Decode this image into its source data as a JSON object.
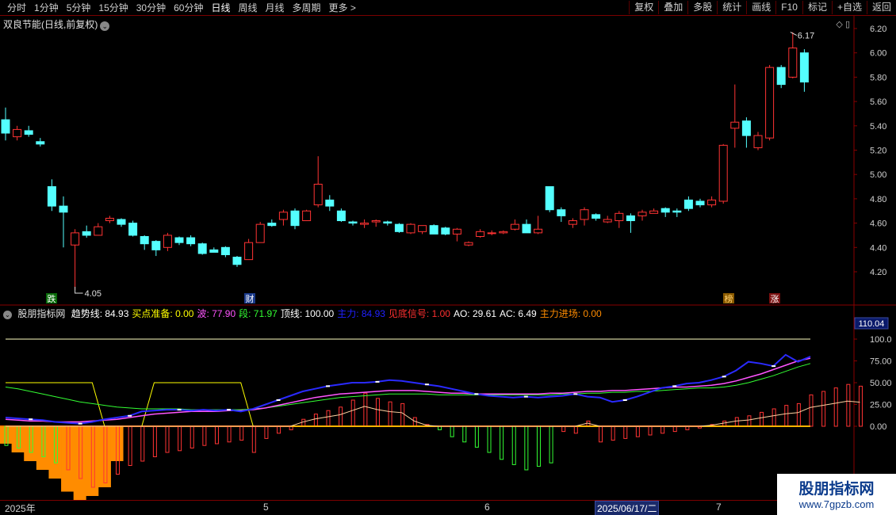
{
  "toolbar": {
    "periods": [
      "分时",
      "1分钟",
      "5分钟",
      "15分钟",
      "30分钟",
      "60分钟",
      "日线",
      "周线",
      "月线",
      "多周期",
      "更多 >"
    ],
    "actions": [
      "复权",
      "叠加",
      "多股",
      "统计",
      "画线",
      "F10",
      "标记",
      "+自选",
      "返回"
    ]
  },
  "main_title": "双良节能(日线,前复权)",
  "price_axis": [
    "6.20",
    "6.00",
    "5.80",
    "5.60",
    "5.40",
    "5.20",
    "5.00",
    "4.80",
    "4.60",
    "4.40",
    "4.20"
  ],
  "annotations": {
    "high": "6.17",
    "low": "4.05"
  },
  "markers": {
    "die": "跌",
    "cai": "财",
    "bang": "榜",
    "zhang": "涨"
  },
  "indicator": {
    "name": "股朋指标网",
    "items": [
      {
        "label": "趋势线: 84.93",
        "color": "#ffffff"
      },
      {
        "label": "买点准备: 0.00",
        "color": "#ffff00"
      },
      {
        "label": "波: 77.90",
        "color": "#ff55ff"
      },
      {
        "label": "段: 71.97",
        "color": "#33ff33"
      },
      {
        "label": "顶线: 100.00",
        "color": "#ffffff"
      },
      {
        "label": "主力: 84.93",
        "color": "#2020ff"
      },
      {
        "label": "见底信号: 1.00",
        "color": "#ff3030"
      },
      {
        "label": "AO: 29.61",
        "color": "#ffffff"
      },
      {
        "label": "AC: 6.49",
        "color": "#ffffff"
      },
      {
        "label": "主力进场: 0.00",
        "color": "#ff8c00"
      }
    ],
    "axis": [
      "100.0",
      "75.00",
      "50.00",
      "25.00",
      "0.00"
    ],
    "axis_top_value": "110.04"
  },
  "dates": {
    "year": "2025年",
    "m5": "5",
    "m6": "6",
    "m7": "7",
    "selected": "2025/06/17/二"
  },
  "watermark": {
    "line1": "股朋指标网",
    "line2": "www.7gpzb.com"
  },
  "chart_data": {
    "type": "candlestick",
    "candles": [
      [
        5.45,
        5.34,
        5.55,
        5.28
      ],
      [
        5.31,
        5.37,
        5.4,
        5.28
      ],
      [
        5.36,
        5.33,
        5.4,
        5.31
      ],
      [
        5.27,
        5.25,
        5.3,
        5.23
      ],
      [
        4.9,
        4.74,
        4.96,
        4.7
      ],
      [
        4.74,
        4.69,
        4.82,
        4.4
      ],
      [
        4.42,
        4.52,
        4.55,
        4.05
      ],
      [
        4.53,
        4.5,
        4.58,
        4.48
      ],
      [
        4.5,
        4.57,
        4.6,
        4.5
      ],
      [
        4.62,
        4.64,
        4.66,
        4.6
      ],
      [
        4.63,
        4.59,
        4.64,
        4.57
      ],
      [
        4.6,
        4.5,
        4.62,
        4.49
      ],
      [
        4.49,
        4.43,
        4.5,
        4.38
      ],
      [
        4.45,
        4.38,
        4.46,
        4.33
      ],
      [
        4.4,
        4.5,
        4.52,
        4.37
      ],
      [
        4.48,
        4.44,
        4.49,
        4.42
      ],
      [
        4.48,
        4.43,
        4.5,
        4.41
      ],
      [
        4.43,
        4.35,
        4.44,
        4.34
      ],
      [
        4.38,
        4.36,
        4.4,
        4.36
      ],
      [
        4.4,
        4.34,
        4.41,
        4.32
      ],
      [
        4.32,
        4.26,
        4.33,
        4.24
      ],
      [
        4.3,
        4.44,
        4.47,
        4.3
      ],
      [
        4.44,
        4.59,
        4.61,
        4.44
      ],
      [
        4.6,
        4.58,
        4.63,
        4.57
      ],
      [
        4.63,
        4.69,
        4.71,
        4.58
      ],
      [
        4.7,
        4.58,
        4.72,
        4.55
      ],
      [
        4.62,
        4.7,
        4.71,
        4.62
      ],
      [
        4.75,
        4.92,
        5.15,
        4.73
      ],
      [
        4.79,
        4.74,
        4.83,
        4.7
      ],
      [
        4.7,
        4.62,
        4.72,
        4.61
      ],
      [
        4.61,
        4.6,
        4.62,
        4.58
      ],
      [
        4.59,
        4.6,
        4.63,
        4.56
      ],
      [
        4.61,
        4.62,
        4.63,
        4.57
      ],
      [
        4.61,
        4.6,
        4.62,
        4.58
      ],
      [
        4.59,
        4.53,
        4.6,
        4.52
      ],
      [
        4.52,
        4.59,
        4.6,
        4.51
      ],
      [
        4.53,
        4.58,
        4.58,
        4.51
      ],
      [
        4.58,
        4.51,
        4.59,
        4.51
      ],
      [
        4.56,
        4.51,
        4.57,
        4.5
      ],
      [
        4.51,
        4.55,
        4.56,
        4.45
      ],
      [
        4.42,
        4.44,
        4.45,
        4.41
      ],
      [
        4.49,
        4.53,
        4.55,
        4.48
      ],
      [
        4.52,
        4.52,
        4.54,
        4.5
      ],
      [
        4.52,
        4.53,
        4.54,
        4.51
      ],
      [
        4.55,
        4.59,
        4.63,
        4.54
      ],
      [
        4.59,
        4.52,
        4.63,
        4.52
      ],
      [
        4.52,
        4.55,
        4.66,
        4.51
      ],
      [
        4.9,
        4.71,
        4.9,
        4.69
      ],
      [
        4.71,
        4.66,
        4.73,
        4.61
      ],
      [
        4.59,
        4.62,
        4.64,
        4.56
      ],
      [
        4.63,
        4.71,
        4.73,
        4.58
      ],
      [
        4.67,
        4.64,
        4.68,
        4.62
      ],
      [
        4.61,
        4.63,
        4.66,
        4.6
      ],
      [
        4.62,
        4.68,
        4.7,
        4.56
      ],
      [
        4.66,
        4.62,
        4.68,
        4.52
      ],
      [
        4.66,
        4.69,
        4.71,
        4.62
      ],
      [
        4.68,
        4.7,
        4.72,
        4.68
      ],
      [
        4.72,
        4.69,
        4.73,
        4.65
      ],
      [
        4.7,
        4.69,
        4.72,
        4.65
      ],
      [
        4.79,
        4.72,
        4.82,
        4.7
      ],
      [
        4.78,
        4.75,
        4.8,
        4.73
      ],
      [
        4.75,
        4.79,
        4.82,
        4.73
      ],
      [
        4.78,
        5.24,
        5.25,
        4.76
      ],
      [
        5.38,
        5.43,
        5.74,
        5.22
      ],
      [
        5.44,
        5.32,
        5.47,
        5.22
      ],
      [
        5.22,
        5.32,
        5.35,
        5.2
      ],
      [
        5.3,
        5.88,
        5.9,
        5.28
      ],
      [
        5.88,
        5.74,
        5.9,
        5.71
      ],
      [
        5.8,
        6.04,
        6.17,
        5.79
      ],
      [
        6.0,
        5.76,
        6.03,
        5.68
      ]
    ],
    "indicator_series": {
      "trend": [
        10,
        9,
        8,
        7,
        5,
        4,
        3,
        5,
        8,
        10,
        12,
        17,
        18,
        19,
        19,
        18,
        19,
        18,
        19,
        17,
        20,
        25,
        30,
        35,
        40,
        43,
        46,
        48,
        50,
        50,
        51,
        53,
        52,
        50,
        48,
        46,
        43,
        40,
        37,
        35,
        34,
        33,
        34,
        33,
        34,
        35,
        37,
        34,
        33,
        28,
        30,
        34,
        39,
        44,
        46,
        49,
        50,
        53,
        57,
        64,
        74,
        72,
        69,
        82,
        74,
        80
      ],
      "bo": [
        8,
        7,
        6,
        6,
        5,
        5,
        5,
        6,
        7,
        8,
        10,
        12,
        14,
        15,
        16,
        17,
        17,
        17,
        18,
        18,
        19,
        21,
        24,
        27,
        30,
        33,
        35,
        37,
        38,
        39,
        40,
        41,
        41,
        41,
        40,
        39,
        38,
        38,
        37,
        37,
        37,
        37,
        37,
        37,
        38,
        38,
        39,
        40,
        40,
        41,
        41,
        42,
        43,
        44,
        45,
        45,
        46,
        47,
        49,
        52,
        56,
        60,
        65,
        70,
        75,
        78
      ],
      "duan": [
        45,
        43,
        40,
        37,
        34,
        31,
        28,
        26,
        24,
        22,
        21,
        20,
        20,
        20,
        20,
        19,
        19,
        19,
        19,
        19,
        20,
        21,
        23,
        25,
        27,
        29,
        31,
        33,
        34,
        35,
        36,
        37,
        37,
        37,
        37,
        36,
        36,
        36,
        36,
        36,
        36,
        36,
        36,
        36,
        36,
        37,
        37,
        38,
        38,
        39,
        39,
        40,
        40,
        41,
        42,
        43,
        44,
        44,
        45,
        47,
        50,
        54,
        58,
        63,
        68,
        72
      ],
      "maipan": [
        50,
        50,
        50,
        50,
        50,
        50,
        50,
        50,
        0,
        0,
        0,
        0,
        50,
        50,
        50,
        50,
        50,
        50,
        50,
        50,
        0,
        0,
        0,
        0,
        0,
        0,
        0,
        0,
        0,
        0,
        0,
        0,
        0,
        0,
        0,
        0,
        0,
        0,
        0,
        0,
        0,
        0,
        0,
        0,
        0,
        0,
        0,
        0,
        0,
        0,
        0,
        0,
        0,
        0,
        0,
        0,
        0,
        0,
        0,
        0,
        0,
        0,
        0,
        0,
        0,
        0
      ],
      "ao": [
        -22,
        -25,
        -30,
        -35,
        -42,
        -50,
        -60,
        -70,
        -65,
        -55,
        -45,
        -40,
        -35,
        -30,
        -28,
        -25,
        -22,
        -20,
        -18,
        -16,
        -30,
        -14,
        -8,
        -4,
        8,
        14,
        18,
        22,
        30,
        38,
        32,
        28,
        26,
        10,
        2,
        -4,
        -12,
        -18,
        -24,
        -30,
        -38,
        -44,
        -50,
        -46,
        -42,
        -6,
        -8,
        6,
        -18,
        -16,
        -14,
        -12,
        -10,
        -8,
        -6,
        -4,
        -2,
        2,
        6,
        10,
        12,
        16,
        20,
        24,
        26,
        36,
        40,
        44,
        48,
        46
      ],
      "zhuli_jinchang": [
        -20,
        -30,
        -40,
        -50,
        -60,
        -75,
        -85,
        -80,
        -70,
        -40,
        0,
        0,
        0,
        0,
        0,
        0,
        0,
        0,
        0,
        0,
        0,
        0,
        0,
        0,
        0,
        0,
        0,
        0,
        0,
        0,
        0,
        0,
        0,
        0,
        0,
        0,
        0,
        0,
        0,
        0,
        0,
        0,
        0,
        0,
        0,
        0,
        0,
        0,
        0,
        0,
        0,
        0,
        0,
        0,
        0,
        0,
        0,
        0,
        0,
        0,
        0,
        0,
        0,
        0,
        0,
        0
      ]
    },
    "price_ylim": [
      4.05,
      6.25
    ],
    "indicator_ylim": [
      -85,
      110
    ]
  }
}
